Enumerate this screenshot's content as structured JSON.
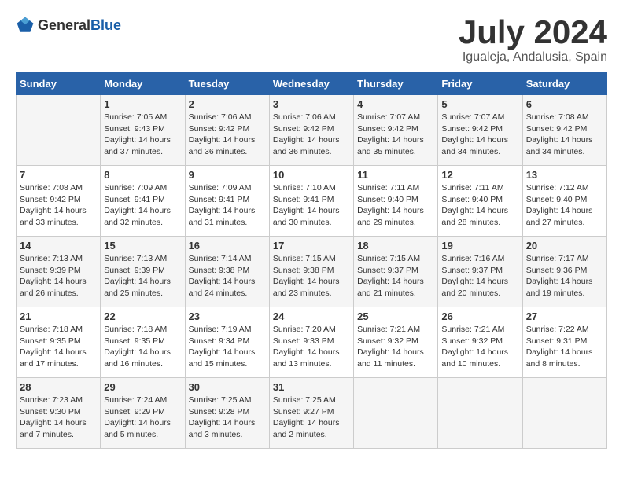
{
  "logo": {
    "general": "General",
    "blue": "Blue"
  },
  "header": {
    "month": "July 2024",
    "location": "Igualeja, Andalusia, Spain"
  },
  "days_of_week": [
    "Sunday",
    "Monday",
    "Tuesday",
    "Wednesday",
    "Thursday",
    "Friday",
    "Saturday"
  ],
  "weeks": [
    [
      {
        "day": "",
        "info": ""
      },
      {
        "day": "1",
        "info": "Sunrise: 7:05 AM\nSunset: 9:43 PM\nDaylight: 14 hours\nand 37 minutes."
      },
      {
        "day": "2",
        "info": "Sunrise: 7:06 AM\nSunset: 9:42 PM\nDaylight: 14 hours\nand 36 minutes."
      },
      {
        "day": "3",
        "info": "Sunrise: 7:06 AM\nSunset: 9:42 PM\nDaylight: 14 hours\nand 36 minutes."
      },
      {
        "day": "4",
        "info": "Sunrise: 7:07 AM\nSunset: 9:42 PM\nDaylight: 14 hours\nand 35 minutes."
      },
      {
        "day": "5",
        "info": "Sunrise: 7:07 AM\nSunset: 9:42 PM\nDaylight: 14 hours\nand 34 minutes."
      },
      {
        "day": "6",
        "info": "Sunrise: 7:08 AM\nSunset: 9:42 PM\nDaylight: 14 hours\nand 34 minutes."
      }
    ],
    [
      {
        "day": "7",
        "info": "Sunrise: 7:08 AM\nSunset: 9:42 PM\nDaylight: 14 hours\nand 33 minutes."
      },
      {
        "day": "8",
        "info": "Sunrise: 7:09 AM\nSunset: 9:41 PM\nDaylight: 14 hours\nand 32 minutes."
      },
      {
        "day": "9",
        "info": "Sunrise: 7:09 AM\nSunset: 9:41 PM\nDaylight: 14 hours\nand 31 minutes."
      },
      {
        "day": "10",
        "info": "Sunrise: 7:10 AM\nSunset: 9:41 PM\nDaylight: 14 hours\nand 30 minutes."
      },
      {
        "day": "11",
        "info": "Sunrise: 7:11 AM\nSunset: 9:40 PM\nDaylight: 14 hours\nand 29 minutes."
      },
      {
        "day": "12",
        "info": "Sunrise: 7:11 AM\nSunset: 9:40 PM\nDaylight: 14 hours\nand 28 minutes."
      },
      {
        "day": "13",
        "info": "Sunrise: 7:12 AM\nSunset: 9:40 PM\nDaylight: 14 hours\nand 27 minutes."
      }
    ],
    [
      {
        "day": "14",
        "info": "Sunrise: 7:13 AM\nSunset: 9:39 PM\nDaylight: 14 hours\nand 26 minutes."
      },
      {
        "day": "15",
        "info": "Sunrise: 7:13 AM\nSunset: 9:39 PM\nDaylight: 14 hours\nand 25 minutes."
      },
      {
        "day": "16",
        "info": "Sunrise: 7:14 AM\nSunset: 9:38 PM\nDaylight: 14 hours\nand 24 minutes."
      },
      {
        "day": "17",
        "info": "Sunrise: 7:15 AM\nSunset: 9:38 PM\nDaylight: 14 hours\nand 23 minutes."
      },
      {
        "day": "18",
        "info": "Sunrise: 7:15 AM\nSunset: 9:37 PM\nDaylight: 14 hours\nand 21 minutes."
      },
      {
        "day": "19",
        "info": "Sunrise: 7:16 AM\nSunset: 9:37 PM\nDaylight: 14 hours\nand 20 minutes."
      },
      {
        "day": "20",
        "info": "Sunrise: 7:17 AM\nSunset: 9:36 PM\nDaylight: 14 hours\nand 19 minutes."
      }
    ],
    [
      {
        "day": "21",
        "info": "Sunrise: 7:18 AM\nSunset: 9:35 PM\nDaylight: 14 hours\nand 17 minutes."
      },
      {
        "day": "22",
        "info": "Sunrise: 7:18 AM\nSunset: 9:35 PM\nDaylight: 14 hours\nand 16 minutes."
      },
      {
        "day": "23",
        "info": "Sunrise: 7:19 AM\nSunset: 9:34 PM\nDaylight: 14 hours\nand 15 minutes."
      },
      {
        "day": "24",
        "info": "Sunrise: 7:20 AM\nSunset: 9:33 PM\nDaylight: 14 hours\nand 13 minutes."
      },
      {
        "day": "25",
        "info": "Sunrise: 7:21 AM\nSunset: 9:32 PM\nDaylight: 14 hours\nand 11 minutes."
      },
      {
        "day": "26",
        "info": "Sunrise: 7:21 AM\nSunset: 9:32 PM\nDaylight: 14 hours\nand 10 minutes."
      },
      {
        "day": "27",
        "info": "Sunrise: 7:22 AM\nSunset: 9:31 PM\nDaylight: 14 hours\nand 8 minutes."
      }
    ],
    [
      {
        "day": "28",
        "info": "Sunrise: 7:23 AM\nSunset: 9:30 PM\nDaylight: 14 hours\nand 7 minutes."
      },
      {
        "day": "29",
        "info": "Sunrise: 7:24 AM\nSunset: 9:29 PM\nDaylight: 14 hours\nand 5 minutes."
      },
      {
        "day": "30",
        "info": "Sunrise: 7:25 AM\nSunset: 9:28 PM\nDaylight: 14 hours\nand 3 minutes."
      },
      {
        "day": "31",
        "info": "Sunrise: 7:25 AM\nSunset: 9:27 PM\nDaylight: 14 hours\nand 2 minutes."
      },
      {
        "day": "",
        "info": ""
      },
      {
        "day": "",
        "info": ""
      },
      {
        "day": "",
        "info": ""
      }
    ]
  ]
}
